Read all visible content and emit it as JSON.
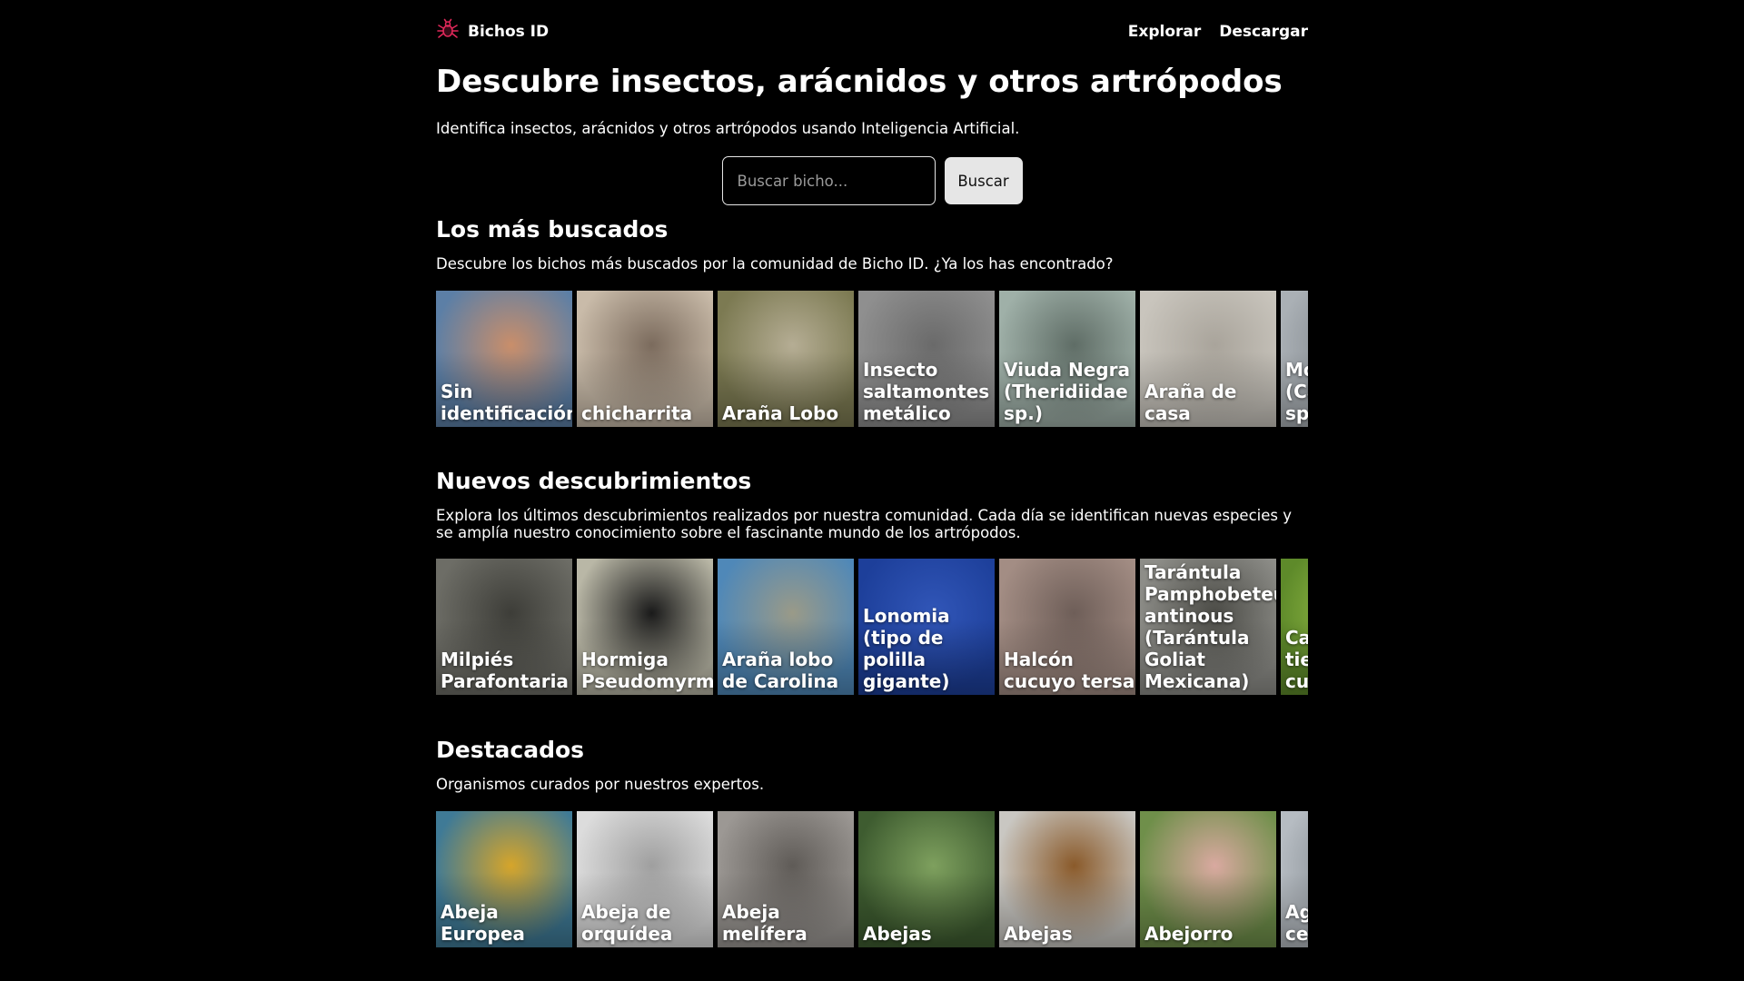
{
  "brand": {
    "name": "Bichos ID",
    "accent": "#e0285a"
  },
  "nav": {
    "explore": "Explorar",
    "download": "Descargar"
  },
  "hero": {
    "title": "Descubre insectos, arácnidos y otros artrópodos",
    "subtitle": "Identifica insectos, arácnidos y otros artrópodos usando Inteligencia Artificial."
  },
  "search": {
    "placeholder": "Buscar bicho...",
    "button": "Buscar"
  },
  "sections": [
    {
      "title": "Los más buscados",
      "description": "Descubre los bichos más buscados por la comunidad de Bicho ID. ¿Ya los has encontrado?",
      "cards": [
        {
          "label": "Sin identificación",
          "colors": [
            "#5c7fa6",
            "#c98e6a"
          ]
        },
        {
          "label": "chicharrita",
          "colors": [
            "#c9bba9",
            "#7b6b5d"
          ]
        },
        {
          "label": "Araña Lobo",
          "colors": [
            "#7c7a52",
            "#b5ad94"
          ]
        },
        {
          "label": "Insecto saltamontes metálico",
          "colors": [
            "#8f8f8f",
            "#6a6a6a"
          ]
        },
        {
          "label": "Viuda Negra (Theridiidae sp.)",
          "colors": [
            "#9fb0a8",
            "#5f6d66"
          ]
        },
        {
          "label": "Araña de casa",
          "colors": [
            "#c9c5bd",
            "#a9a49b"
          ]
        },
        {
          "label": "Mosca (Calliphoridae sp.)",
          "colors": [
            "#aab0b5",
            "#7b8187"
          ]
        }
      ]
    },
    {
      "title": "Nuevos descubrimientos",
      "description": "Explora los últimos descubrimientos realizados por nuestra comunidad. Cada día se identifican nuevas especies y se amplía nuestro conocimiento sobre el fascinante mundo de los artrópodos.",
      "cards": [
        {
          "label": "Milpiés Parafontaria",
          "colors": [
            "#6d6d66",
            "#3d3d38"
          ]
        },
        {
          "label": "Hormiga Pseudomyrmex",
          "colors": [
            "#b9b7a6",
            "#1a1a1a"
          ]
        },
        {
          "label": "Araña lobo de Carolina",
          "colors": [
            "#4f88b8",
            "#9a9a88"
          ]
        },
        {
          "label": "Lonomia (tipo de polilla gigante)",
          "colors": [
            "#1d3f9a",
            "#3156b8"
          ]
        },
        {
          "label": "Halcón cucuyo tersa",
          "colors": [
            "#a38d84",
            "#6e5e58"
          ]
        },
        {
          "label": "Tarántula Pamphobeteus antinous (Tarántula Goliat Mexicana)",
          "colors": [
            "#8d8d88",
            "#4b4b46"
          ]
        },
        {
          "label": "Caracol tierra cubano",
          "colors": [
            "#5e8a2a",
            "#9cc24a"
          ]
        }
      ]
    },
    {
      "title": "Destacados",
      "description": "Organismos curados por nuestros expertos.",
      "cards": [
        {
          "label": "Abeja Europea",
          "colors": [
            "#3f7a96",
            "#d6a52a"
          ]
        },
        {
          "label": "Abeja de orquídea",
          "colors": [
            "#dcdcdc",
            "#9f9f9f"
          ]
        },
        {
          "label": "Abeja melífera",
          "colors": [
            "#9c9894",
            "#5f5b57"
          ]
        },
        {
          "label": "Abejas",
          "colors": [
            "#3e5c30",
            "#7ea05e"
          ]
        },
        {
          "label": "Abejas",
          "colors": [
            "#c9c7c2",
            "#8a5a2a"
          ]
        },
        {
          "label": "Abejorro",
          "colors": [
            "#6f8f4a",
            "#d9a9a0"
          ]
        },
        {
          "label": "Agave cerambícido",
          "colors": [
            "#b6bcc2",
            "#7c8389"
          ]
        }
      ]
    }
  ]
}
